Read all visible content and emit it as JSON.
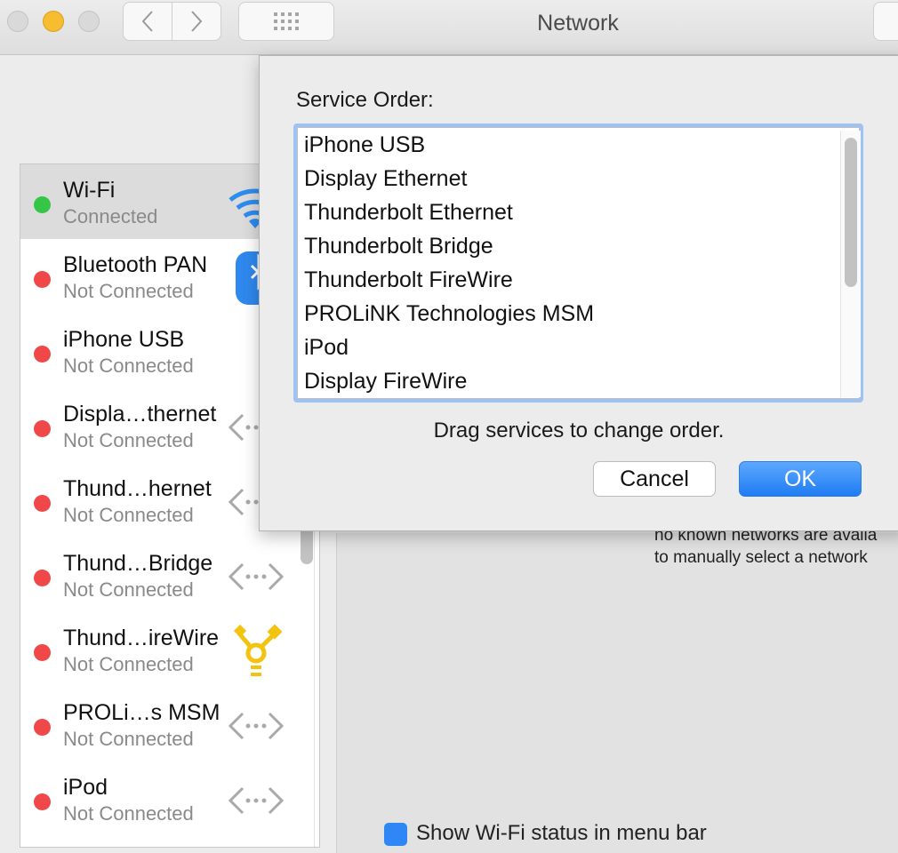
{
  "window": {
    "title": "Network"
  },
  "toolbar": {
    "back_icon": "chevron-left-icon",
    "forward_icon": "chevron-right-icon",
    "grid_icon": "grid-icon"
  },
  "sidebar": {
    "services": [
      {
        "name": "Wi-Fi",
        "status": "Connected",
        "status_color": "#35c648",
        "icon": "wifi-icon",
        "selected": true
      },
      {
        "name": "Bluetooth PAN",
        "status": "Not Connected",
        "status_color": "#f04848",
        "icon": "bluetooth-icon"
      },
      {
        "name": "iPhone USB",
        "status": "Not Connected",
        "status_color": "#f04848",
        "icon": "iphone-icon"
      },
      {
        "name": "Displa…thernet",
        "status": "Not Connected",
        "status_color": "#f04848",
        "icon": "ethernet-icon"
      },
      {
        "name": "Thund…hernet",
        "status": "Not Connected",
        "status_color": "#f04848",
        "icon": "ethernet-icon"
      },
      {
        "name": "Thund…Bridge",
        "status": "Not Connected",
        "status_color": "#f04848",
        "icon": "ethernet-icon"
      },
      {
        "name": "Thund…ireWire",
        "status": "Not Connected",
        "status_color": "#f04848",
        "icon": "firewire-icon"
      },
      {
        "name": "PROLi…s MSM",
        "status": "Not Connected",
        "status_color": "#f04848",
        "icon": "ethernet-icon"
      },
      {
        "name": "iPod",
        "status": "Not Connected",
        "status_color": "#f04848",
        "icon": "ethernet-icon"
      }
    ]
  },
  "main": {
    "info_line1": "no known networks are availa",
    "info_line2": "to manually select a network",
    "show_wifi_status_label": "Show Wi-Fi status in menu bar",
    "show_wifi_status_checked": true
  },
  "sheet": {
    "label": "Service Order:",
    "items": [
      "iPhone USB",
      "Display Ethernet",
      "Thunderbolt Ethernet",
      "Thunderbolt Bridge",
      "Thunderbolt FireWire",
      "PROLiNK Technologies MSM",
      "iPod",
      "Display FireWire"
    ],
    "hint": "Drag services to change order.",
    "cancel_label": "Cancel",
    "ok_label": "OK",
    "accent_color": "#1f7cf2"
  }
}
